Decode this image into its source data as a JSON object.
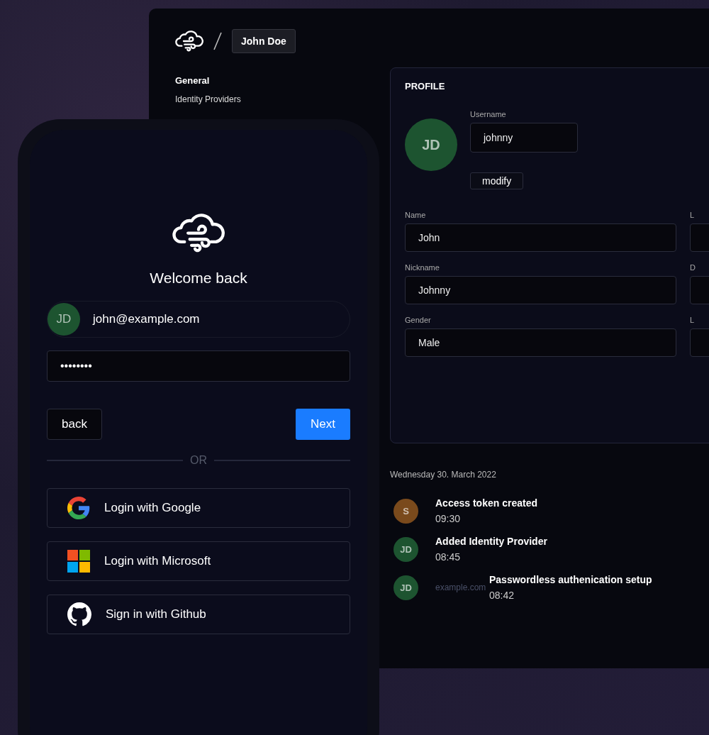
{
  "desktop": {
    "breadcrumb_user": "John Doe",
    "nav": [
      {
        "label": "General",
        "selected": true
      },
      {
        "label": "Identity Providers",
        "selected": false
      }
    ],
    "profile": {
      "title": "PROFILE",
      "avatar": {
        "initials": "JD",
        "color": "#1d5430"
      },
      "username": {
        "label": "Username",
        "value": "johnny"
      },
      "modify_button": "modify",
      "fields": [
        {
          "label": "Name",
          "value": "John"
        },
        {
          "label": "Nickname",
          "value": "Johnny"
        },
        {
          "label": "Gender",
          "value": "Male"
        }
      ],
      "column_2_fields": [
        {
          "label": "L"
        },
        {
          "label": "D"
        },
        {
          "label": "L"
        }
      ]
    },
    "activity": {
      "date": "Wednesday 30. March 2022",
      "items": [
        {
          "initials": "S",
          "color": "#7a4a1c",
          "title": "Access token created",
          "time": "09:30"
        },
        {
          "initials": "JD",
          "color": "#1d5430",
          "title": "Added Identity Provider",
          "time": "08:45"
        },
        {
          "initials": "JD",
          "color": "#1d5430",
          "source": "example.com",
          "title": "Passwordless authenication setup",
          "time": "08:42"
        }
      ]
    }
  },
  "login": {
    "heading": "Welcome back",
    "account": {
      "initials": "JD",
      "color": "#1d5430",
      "email": "john@example.com"
    },
    "password": {
      "value": "••••••••"
    },
    "back_button": "back",
    "next_button": "Next",
    "divider": "OR",
    "providers": [
      {
        "kind": "google",
        "label": "Login with Google"
      },
      {
        "kind": "microsoft",
        "label": "Login with Microsoft"
      },
      {
        "kind": "github",
        "label": "Sign in with Github"
      }
    ]
  }
}
